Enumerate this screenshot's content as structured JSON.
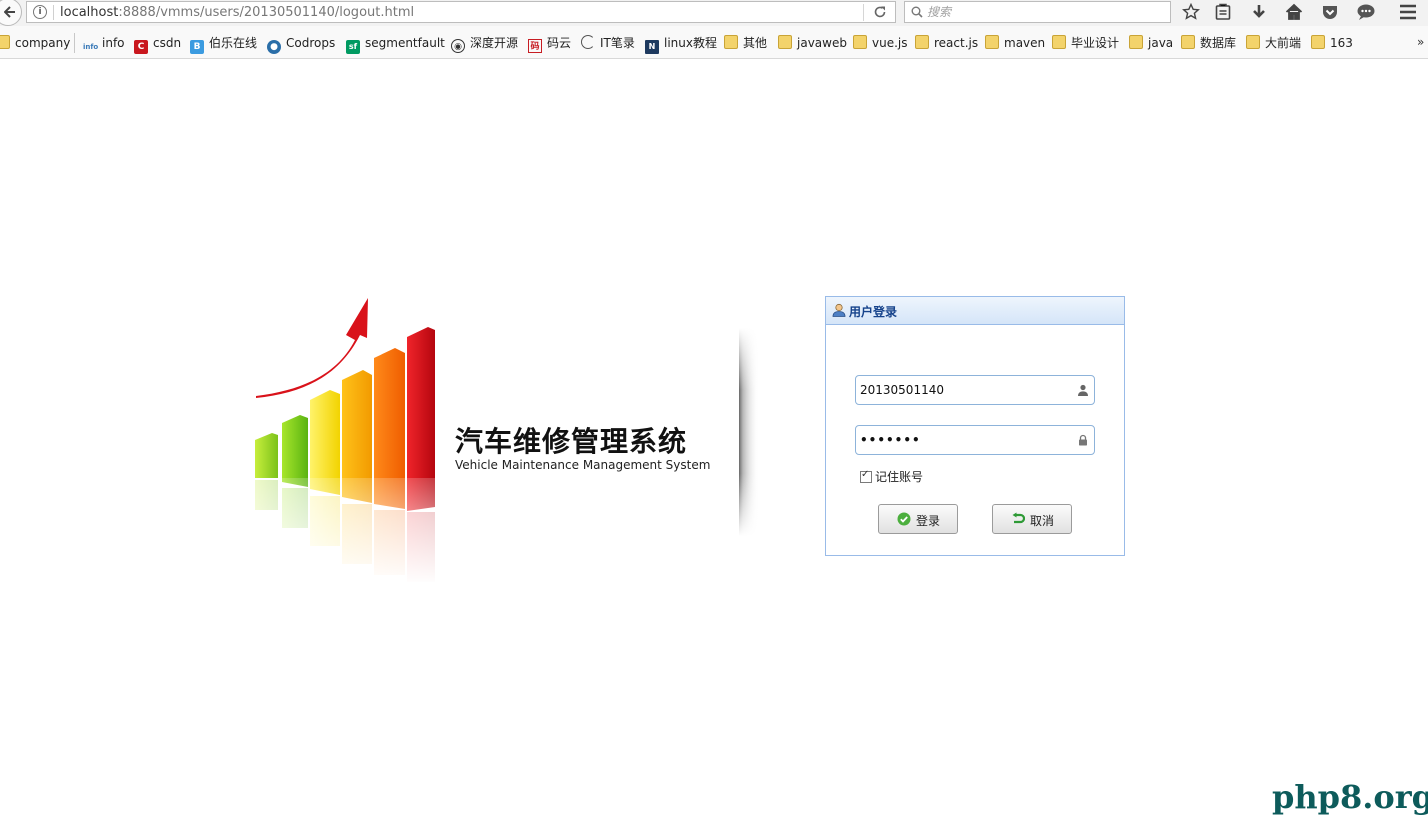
{
  "browser": {
    "url_host": "localhost",
    "url_rest": ":8888/vmms/users/20130501140/logout.html",
    "search_placeholder": "搜索"
  },
  "bookmarks": [
    {
      "label": "company",
      "icon": "folder-icon"
    },
    {
      "label": "info",
      "icon": "info-site-icon"
    },
    {
      "label": "csdn",
      "icon": "csdn-icon"
    },
    {
      "label": "伯乐在线",
      "icon": "jobbole-icon"
    },
    {
      "label": "Codrops",
      "icon": "codrops-icon"
    },
    {
      "label": "segmentfault",
      "icon": "segmentfault-icon"
    },
    {
      "label": "深度开源",
      "icon": "open-source-icon"
    },
    {
      "label": "码云",
      "icon": "gitee-icon"
    },
    {
      "label": "IT笔录",
      "icon": "it-notes-icon"
    },
    {
      "label": "linux教程",
      "icon": "linux-icon"
    },
    {
      "label": "其他",
      "icon": "folder-icon"
    },
    {
      "label": "javaweb",
      "icon": "folder-icon"
    },
    {
      "label": "vue.js",
      "icon": "folder-icon"
    },
    {
      "label": "react.js",
      "icon": "folder-icon"
    },
    {
      "label": "maven",
      "icon": "folder-icon"
    },
    {
      "label": "毕业设计",
      "icon": "folder-icon"
    },
    {
      "label": "java",
      "icon": "folder-icon"
    },
    {
      "label": "数据库",
      "icon": "folder-icon"
    },
    {
      "label": "大前端",
      "icon": "folder-icon"
    },
    {
      "label": "163",
      "icon": "folder-icon"
    }
  ],
  "logo": {
    "title": "汽车维修管理系统",
    "subtitle": "Vehicle Maintenance Management System"
  },
  "login": {
    "title": "用户登录",
    "username": "20130501140",
    "password": "•••••••",
    "remember_label": "记住账号",
    "remember_checked": true,
    "login_button": "登录",
    "cancel_button": "取消"
  },
  "watermark": "php8.org"
}
